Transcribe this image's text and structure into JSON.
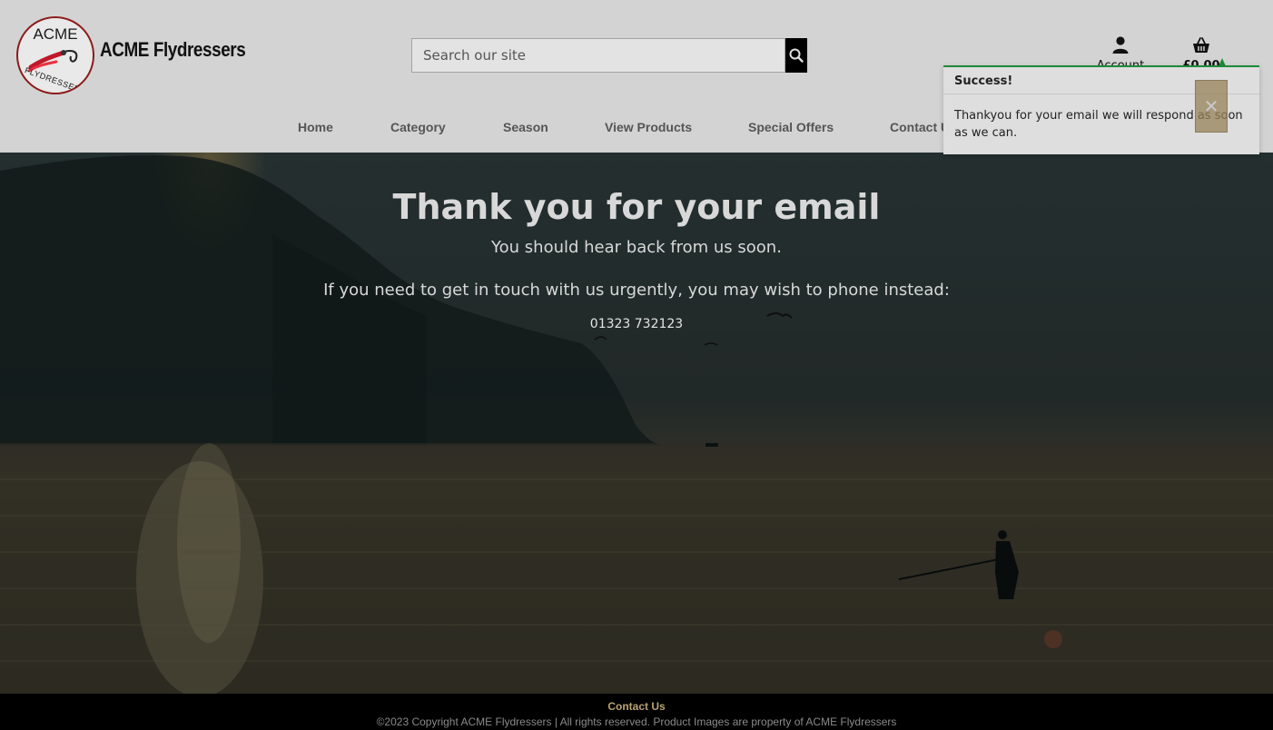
{
  "brand": {
    "badge_top": "ACME",
    "badge_bottom": "FLYDRESSERS",
    "name": "ACME Flydressers"
  },
  "search": {
    "placeholder": "Search our site",
    "icon": "search-icon"
  },
  "account": {
    "label": "Account",
    "icon": "user-icon"
  },
  "basket": {
    "total": "£0.00",
    "icon": "basket-icon"
  },
  "nav": {
    "items": [
      "Home",
      "Category",
      "Season",
      "View Products",
      "Special Offers",
      "Contact Us"
    ]
  },
  "hero": {
    "title": "Thank you for your email",
    "subtitle": "You should hear back from us soon.",
    "urgent": "If you need to get in touch with us urgently, you may wish to phone instead:",
    "phone": "01323 732123"
  },
  "toast": {
    "title": "Success!",
    "message": "Thankyou for your email we will respond as soon as we can.",
    "close_icon": "close-icon"
  },
  "footer": {
    "link": "Contact Us",
    "copyright": "©2023 Copyright ACME Flydressers | All rights reserved. Product Images are property of ACME Flydressers"
  },
  "colors": {
    "header_bg": "#d3d3d3",
    "toast_accent": "#1e8a3a",
    "footer_link": "#b8a273"
  }
}
